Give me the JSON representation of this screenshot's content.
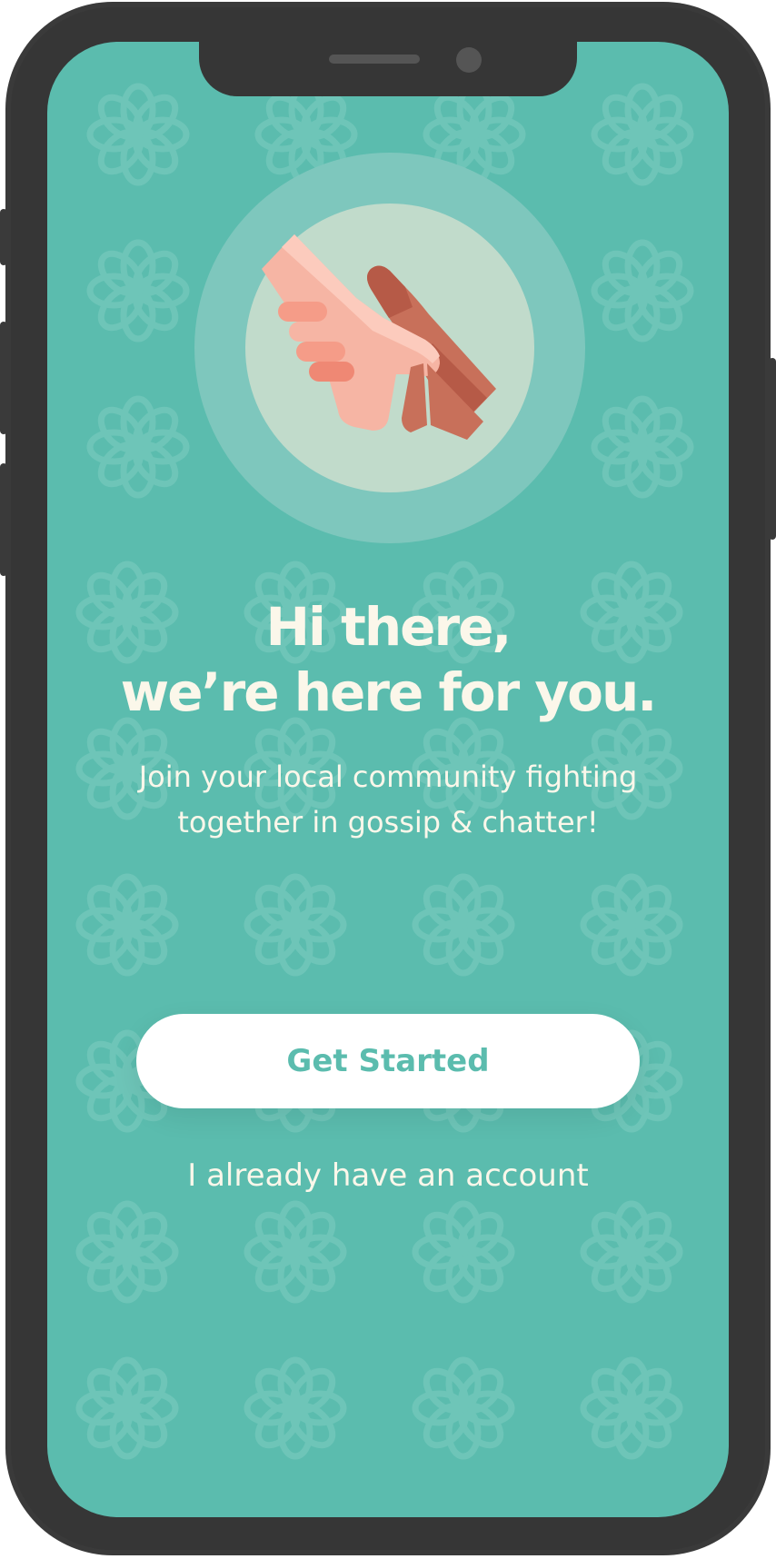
{
  "welcome": {
    "title_line1": "Hi there,",
    "title_line2": "we’re here for you.",
    "subtitle_line1": "Join your local community fighting",
    "subtitle_line2": "together in gossip & chatter!",
    "primary_button": "Get Started",
    "secondary_link": "I already have an account"
  },
  "icons": {
    "hero": "helping-hands-icon",
    "background_pattern": "flower-icon"
  },
  "colors": {
    "screen_background": "#5bbcae",
    "text_light": "#fbf7ea",
    "button_background": "#ffffff",
    "button_text": "#5bbcae",
    "device_frame": "#3a3a3a"
  }
}
